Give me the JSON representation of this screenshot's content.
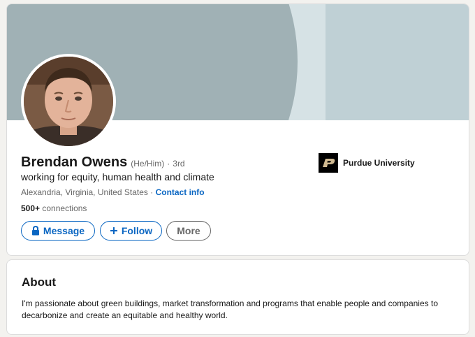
{
  "profile": {
    "name": "Brendan Owens",
    "pronouns": "(He/Him)",
    "separator": "·",
    "degree": "3rd",
    "headline": "working for equity, human health and climate",
    "location": "Alexandria, Virginia, United States",
    "location_separator": "·",
    "contact_label": "Contact info",
    "connections_count": "500+",
    "connections_label": "connections",
    "education": "Purdue University"
  },
  "actions": {
    "message_label": "Message",
    "follow_label": "Follow",
    "more_label": "More"
  },
  "about": {
    "title": "About",
    "text": "I'm passionate about green buildings, market transformation and programs that enable people and companies to decarbonize and create an equitable and healthy world."
  },
  "icons": {
    "message": "lock-icon",
    "follow": "plus-icon",
    "education_logo": "purdue-logo"
  },
  "colors": {
    "accent": "#0a66c2",
    "banner_dark": "#a0b1b5",
    "banner_light": "#bfd0d5"
  }
}
